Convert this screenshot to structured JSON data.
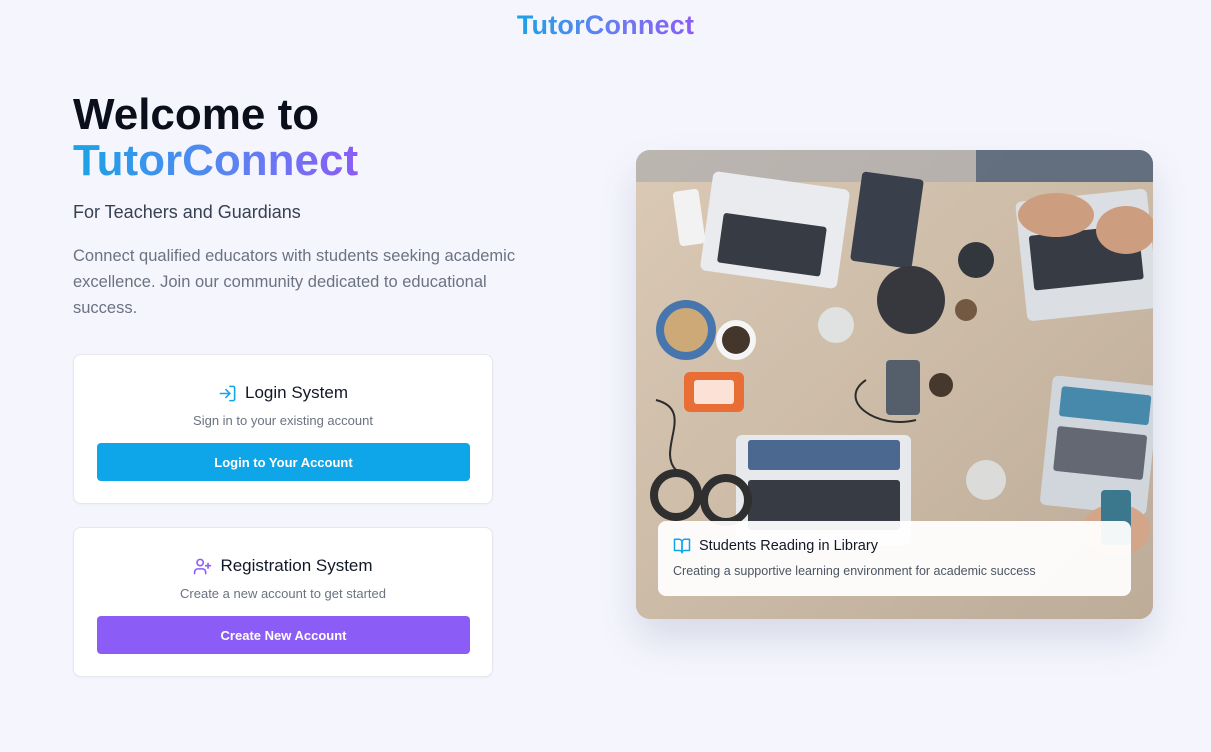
{
  "header": {
    "brand": "TutorConnect"
  },
  "hero": {
    "title_line1": "Welcome to",
    "title_line2": "TutorConnect",
    "subtitle": "For Teachers and Guardians",
    "description": "Connect qualified educators with students seeking academic excellence. Join our community dedicated to educational success."
  },
  "login_card": {
    "title": "Login System",
    "subtitle": "Sign in to your existing account",
    "button": "Login to Your Account",
    "icon": "log-in-icon"
  },
  "register_card": {
    "title": "Registration System",
    "subtitle": "Create a new account to get started",
    "button": "Create New Account",
    "icon": "user-plus-icon"
  },
  "image_caption": {
    "title": "Students Reading in Library",
    "subtitle": "Creating a supportive learning environment for academic success",
    "icon": "book-open-icon"
  },
  "colors": {
    "brand_start": "#1aa3e6",
    "brand_end": "#8b5cf6",
    "login_button": "#0ea5e9",
    "register_button": "#8b5cf6",
    "background": "#f5f6fd"
  }
}
